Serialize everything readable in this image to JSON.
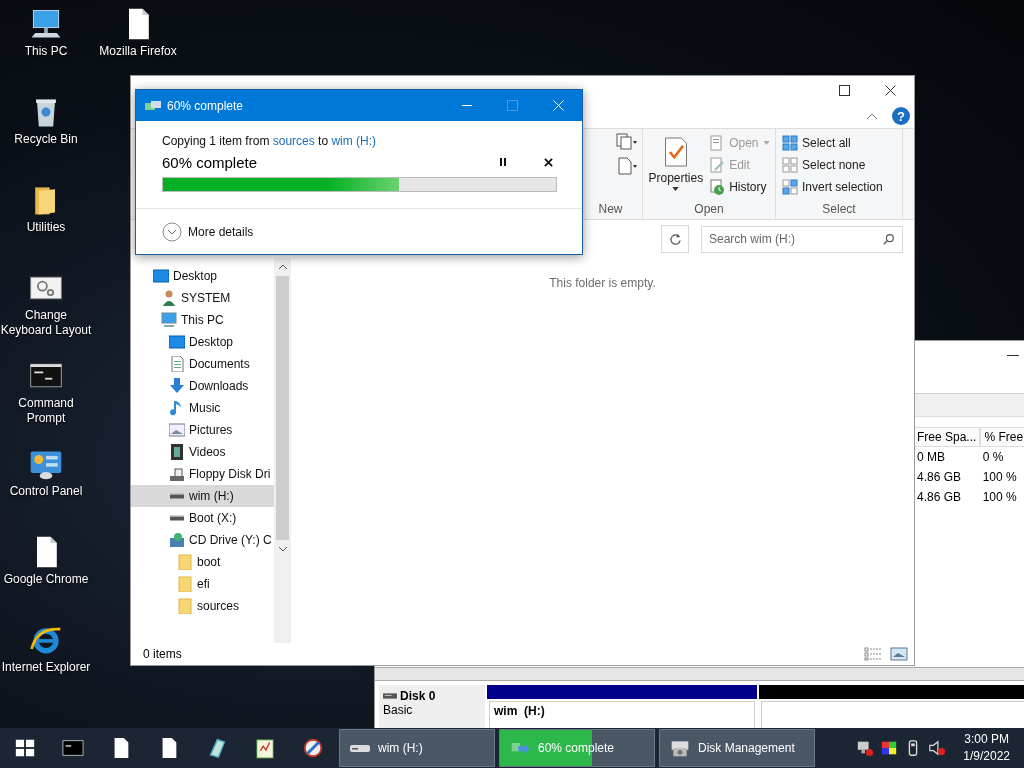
{
  "desktop_icons": [
    {
      "label": "This PC",
      "kind": "pc"
    },
    {
      "label": "Mozilla Firefox",
      "kind": "file"
    },
    {
      "label": "Recycle Bin",
      "kind": "bin"
    },
    {
      "label": "Utilities",
      "kind": "folder"
    },
    {
      "label": "Change Keyboard Layout",
      "kind": "settings"
    },
    {
      "label": "Command Prompt",
      "kind": "cmd"
    },
    {
      "label": "Control Panel",
      "kind": "panel"
    },
    {
      "label": "Google Chrome",
      "kind": "file"
    },
    {
      "label": "Internet Explorer",
      "kind": "ie"
    }
  ],
  "disk_management": {
    "table": {
      "columns": [
        "Free Spa...",
        "% Free"
      ],
      "rows": [
        [
          "0 MB",
          "0 %"
        ],
        [
          "4.86 GB",
          "100 %"
        ],
        [
          "4.86 GB",
          "100 %"
        ]
      ]
    },
    "disk": {
      "name": "Disk 0",
      "type": "Basic"
    },
    "partitions": [
      {
        "kind": "primary",
        "label": "wim  (H:)"
      },
      {
        "kind": "unallocated"
      }
    ]
  },
  "explorer": {
    "help": "?",
    "ribbon": {
      "new_group": {
        "label": "New"
      },
      "open_group": {
        "label": "Open",
        "properties": "Properties",
        "items": [
          {
            "kind": "open",
            "label": "Open",
            "disabled": true
          },
          {
            "kind": "edit",
            "label": "Edit",
            "disabled": true
          },
          {
            "kind": "history",
            "label": "History",
            "disabled": false
          }
        ]
      },
      "select_group": {
        "label": "Select",
        "items": [
          {
            "kind": "all",
            "label": "Select all"
          },
          {
            "kind": "none",
            "label": "Select none"
          },
          {
            "kind": "invert",
            "label": "Invert selection"
          }
        ]
      }
    },
    "search": {
      "placeholder": "Search wim (H:)"
    },
    "nav": [
      {
        "label": "Desktop",
        "kind": "desktop",
        "selected": false,
        "children": [
          {
            "label": "SYSTEM",
            "kind": "user",
            "selected": false
          },
          {
            "label": "This PC",
            "kind": "pc",
            "selected": false,
            "children": [
              {
                "label": "Desktop",
                "kind": "desktop",
                "selected": false
              },
              {
                "label": "Documents",
                "kind": "documents",
                "selected": false
              },
              {
                "label": "Downloads",
                "kind": "downloads",
                "selected": false
              },
              {
                "label": "Music",
                "kind": "music",
                "selected": false
              },
              {
                "label": "Pictures",
                "kind": "pictures",
                "selected": false
              },
              {
                "label": "Videos",
                "kind": "videos",
                "selected": false
              },
              {
                "label": "Floppy Disk Dri",
                "kind": "floppy",
                "selected": false
              },
              {
                "label": "wim (H:)",
                "kind": "drive",
                "selected": true
              },
              {
                "label": "Boot (X:)",
                "kind": "drive",
                "selected": false
              },
              {
                "label": "CD Drive (Y:) C",
                "kind": "cd",
                "selected": false,
                "children": [
                  {
                    "label": "boot",
                    "kind": "folder",
                    "selected": false
                  },
                  {
                    "label": "efi",
                    "kind": "folder",
                    "selected": false
                  },
                  {
                    "label": "sources",
                    "kind": "folder",
                    "selected": false
                  }
                ]
              }
            ]
          }
        ]
      }
    ],
    "empty_message": "This folder is empty.",
    "status": "0 items"
  },
  "copy_dialog": {
    "title": "60% complete",
    "message": {
      "prefix": "Copying 1 item from",
      "source": "sources",
      "middle": "to",
      "destination": "wim (H:)"
    },
    "progress_text": "60% complete",
    "level": 0.6,
    "details_label": "More details"
  },
  "taskbar": {
    "pinned": [
      {
        "kind": "start"
      },
      {
        "kind": "cmd"
      },
      {
        "kind": "file"
      },
      {
        "kind": "file"
      },
      {
        "kind": "notes"
      },
      {
        "kind": "notepad"
      },
      {
        "kind": "paint"
      }
    ],
    "tasks": [
      {
        "label": "wim (H:)",
        "kind": "drive"
      },
      {
        "label": "60% complete",
        "kind": "copy",
        "level": 0.6
      },
      {
        "label": "Disk Management",
        "kind": "disk"
      }
    ],
    "tray": [
      {
        "kind": "network"
      },
      {
        "kind": "display"
      },
      {
        "kind": "usb"
      },
      {
        "kind": "mute"
      }
    ],
    "time": "3:00 PM",
    "date": "1/9/2022"
  }
}
